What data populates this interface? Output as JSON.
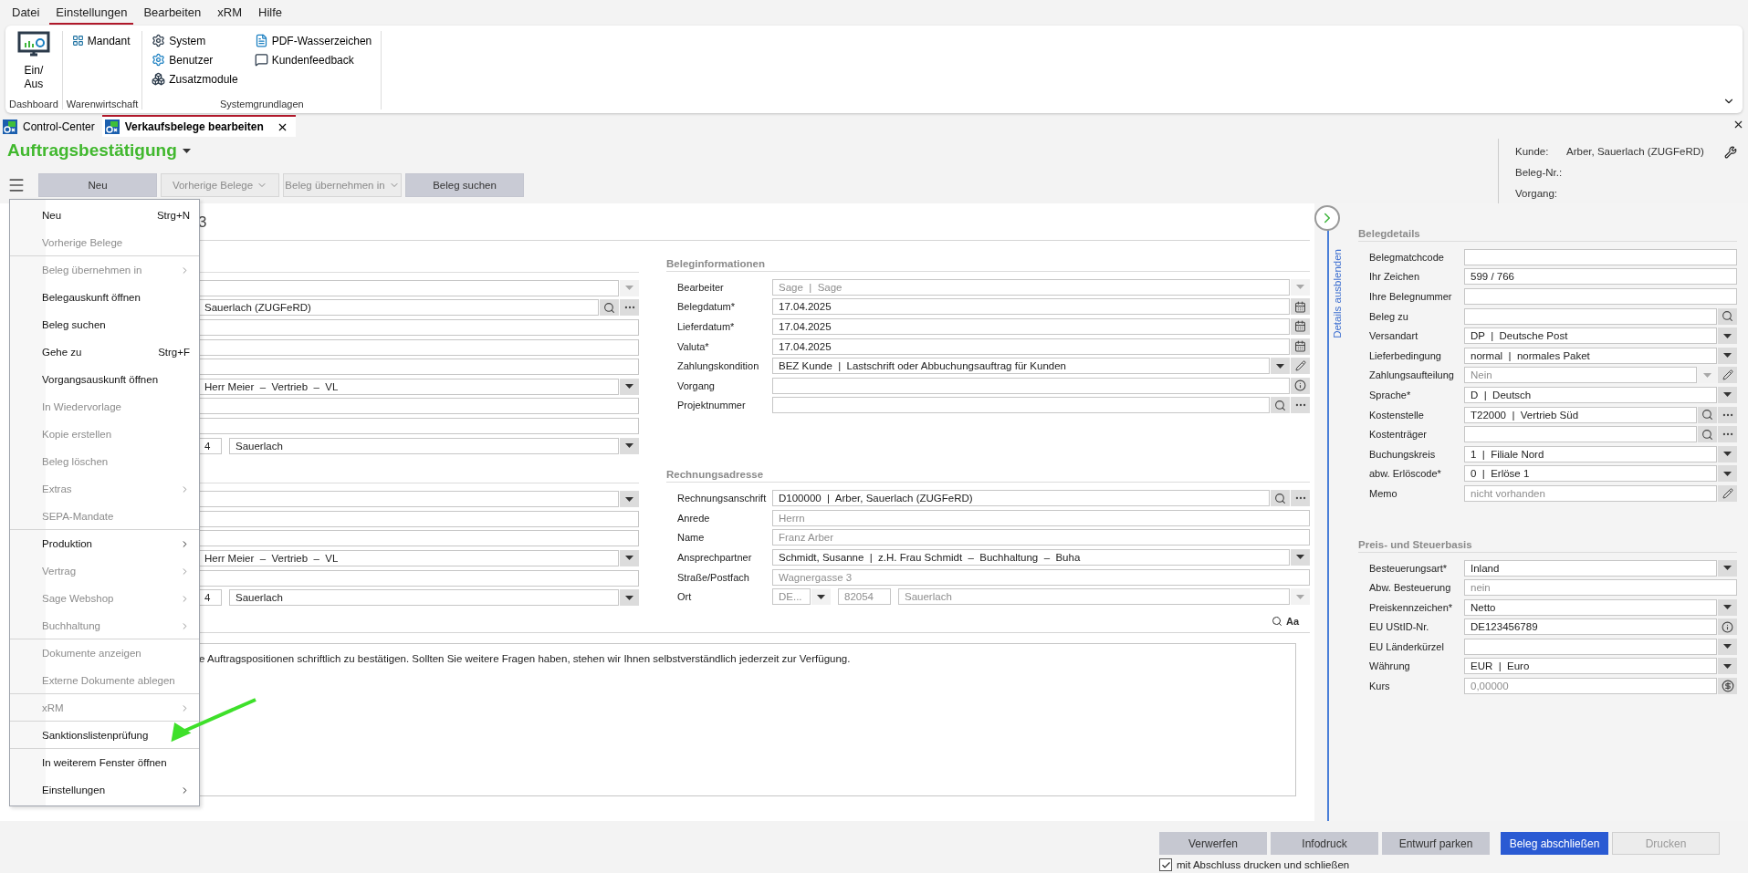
{
  "menu_bar": [
    {
      "label": "Datei",
      "selected": false
    },
    {
      "label": "Einstellungen",
      "selected": true
    },
    {
      "label": "Bearbeiten",
      "selected": false
    },
    {
      "label": "xRM",
      "selected": false
    },
    {
      "label": "Hilfe",
      "selected": false
    }
  ],
  "ribbon": {
    "groups": [
      {
        "label": "Dashboard",
        "kind": "large",
        "items": [
          {
            "label": "Ein/ Aus"
          }
        ]
      },
      {
        "label": "Warenwirtschaft",
        "kind": "small",
        "items": [
          {
            "label": "Mandant"
          }
        ]
      },
      {
        "label": "Systemgrundlagen",
        "kind": "small",
        "items": [
          {
            "label": "System"
          },
          {
            "label": "Benutzer"
          },
          {
            "label": "Zusatzmodule"
          },
          {
            "label": "PDF-Wasserzeichen"
          },
          {
            "label": "Kundenfeedback"
          }
        ]
      }
    ]
  },
  "tabs": [
    {
      "label": "Control-Center",
      "selected": false,
      "closable": false
    },
    {
      "label": "Verkaufsbelege bearbeiten",
      "selected": true,
      "closable": true
    }
  ],
  "document_type": "Auftragsbestätigung",
  "toolbar": [
    {
      "label": "Neu",
      "disabled": false,
      "dropdown": false
    },
    {
      "label": "Vorherige Belege",
      "disabled": true,
      "dropdown": true
    },
    {
      "label": "Beleg übernehmen in",
      "disabled": true,
      "dropdown": true
    },
    {
      "label": "Beleg suchen",
      "disabled": false,
      "dropdown": false
    }
  ],
  "header_info": [
    {
      "label": "Kunde:",
      "value": "Arber, Sauerlach (ZUGFeRD)"
    },
    {
      "label": "Beleg-Nr.:"
    },
    {
      "label": "Vorgang:"
    }
  ],
  "form_title": "3",
  "left_column": [
    {
      "fields": [
        {
          "kind": "select",
          "muted": true
        },
        {
          "kind": "lookup",
          "value": "Sauerlach (ZUGFeRD)",
          "muted": false
        },
        {
          "kind": "text"
        },
        {
          "kind": "text"
        },
        {
          "kind": "text"
        },
        {
          "kind": "select",
          "value": "Herr Meier  –  Vertrieb  –  VL",
          "muted": false
        },
        {
          "kind": "text"
        },
        {
          "kind": "text"
        },
        {
          "kind": "zip_city",
          "zip": "4",
          "city": "Sauerlach",
          "muted": false
        }
      ]
    },
    {
      "fields": [
        {
          "kind": "select",
          "muted": false
        },
        {
          "kind": "text"
        },
        {
          "kind": "text"
        },
        {
          "kind": "select",
          "value": "Herr Meier  –  Vertrieb  –  VL",
          "muted": false
        },
        {
          "kind": "text"
        },
        {
          "kind": "zip_city",
          "zip": "4",
          "city": "Sauerlach",
          "muted": false
        }
      ]
    }
  ],
  "center_column": [
    {
      "title": "Beleginformationen",
      "fields": [
        {
          "label": "Bearbeiter",
          "kind": "select",
          "value": "Sage  |  Sage",
          "muted": true
        },
        {
          "label": "Belegdatum*",
          "kind": "date",
          "value": "17.04.2025",
          "muted": false
        },
        {
          "label": "Lieferdatum*",
          "kind": "date",
          "value": "17.04.2025",
          "muted": false
        },
        {
          "label": "Valuta*",
          "kind": "date",
          "value": "17.04.2025",
          "muted": false
        },
        {
          "label": "Zahlungskondition",
          "kind": "select_edit",
          "value": "BEZ Kunde  |  Lastschrift oder Abbuchungsauftrag für Kunden",
          "muted": false
        },
        {
          "label": "Vorgang",
          "kind": "info"
        },
        {
          "label": "Projektnummer",
          "kind": "lookup"
        }
      ]
    },
    {
      "title": "Rechnungsadresse",
      "fields": [
        {
          "label": "Rechnungsanschrift",
          "kind": "lookup",
          "value": "D100000  |  Arber, Sauerlach (ZUGFeRD)",
          "muted": false
        },
        {
          "label": "Anrede",
          "kind": "text",
          "value": "Herrn",
          "muted": true
        },
        {
          "label": "Name",
          "kind": "text",
          "value": "Franz Arber",
          "muted": true
        },
        {
          "label": "Ansprechpartner",
          "kind": "select",
          "value": "Schmidt, Susanne  |  z.H. Frau Schmidt  –  Buchhaltung  –  Buha",
          "muted": false
        },
        {
          "label": "Straße/Postfach",
          "kind": "text",
          "value": "Wagnergasse 3",
          "muted": true
        },
        {
          "label": "Ort",
          "kind": "address",
          "country": "DE...",
          "zip": "82054",
          "city": "Sauerlach",
          "muted": true
        }
      ]
    }
  ],
  "note_text": "e Auftragspositionen schriftlich zu bestätigen. Sollten Sie weitere Fragen haben, stehen wir Ihnen selbstverständlich jederzeit zur Verfügung.",
  "note_tools": {
    "font_button": "Aa"
  },
  "details_panel": {
    "toggle_label": "Details ausblenden",
    "sections": [
      {
        "title": "Belegdetails",
        "fields": [
          {
            "label": "Belegmatchcode",
            "kind": "text"
          },
          {
            "label": "Ihr Zeichen",
            "kind": "text",
            "value": "599 / 766",
            "muted": false
          },
          {
            "label": "Ihre Belegnummer",
            "kind": "text"
          },
          {
            "label": "Beleg zu",
            "kind": "search"
          },
          {
            "label": "Versandart",
            "kind": "select",
            "value": "DP  |  Deutsche Post",
            "muted": false
          },
          {
            "label": "Lieferbedingung",
            "kind": "select",
            "value": "normal  |  normales Paket",
            "muted": false
          },
          {
            "label": "Zahlungsaufteilung",
            "kind": "select_edit",
            "value": "Nein",
            "muted": true
          },
          {
            "label": "Sprache*",
            "kind": "select",
            "value": "D  |  Deutsch",
            "muted": false
          },
          {
            "label": "Kostenstelle",
            "kind": "lookup",
            "value": "T22000  |  Vertrieb Süd",
            "muted": false
          },
          {
            "label": "Kostenträger",
            "kind": "lookup"
          },
          {
            "label": "Buchungskreis",
            "kind": "select",
            "value": "1  |  Filiale Nord",
            "muted": false
          },
          {
            "label": "abw. Erlöscode*",
            "kind": "select",
            "value": "0  |  Erlöse 1",
            "muted": false
          },
          {
            "label": "Memo",
            "kind": "edit",
            "value": "nicht vorhanden",
            "muted": true
          }
        ]
      },
      {
        "title": "Preis- und Steuerbasis",
        "fields": [
          {
            "label": "Besteuerungsart*",
            "kind": "select",
            "value": "Inland",
            "muted": false
          },
          {
            "label": "Abw. Besteuerung",
            "kind": "text",
            "value": "nein",
            "muted": true
          },
          {
            "label": "Preiskennzeichen*",
            "kind": "select",
            "value": "Netto",
            "muted": false
          },
          {
            "label": "EU UStID-Nr.",
            "kind": "info",
            "value": "DE123456789",
            "muted": false
          },
          {
            "label": "EU Länderkürzel",
            "kind": "select",
            "muted": false
          },
          {
            "label": "Währung",
            "kind": "select",
            "value": "EUR  |  Euro",
            "muted": false
          },
          {
            "label": "Kurs",
            "kind": "currency",
            "value": "0,00000",
            "muted": true
          }
        ]
      }
    ]
  },
  "context_menu": [
    {
      "label": "Neu",
      "shortcut": "Strg+N",
      "disabled": false,
      "submenu": false,
      "divider": false
    },
    {
      "label": "Vorherige Belege",
      "disabled": true,
      "submenu": false,
      "divider": true
    },
    {
      "label": "Beleg übernehmen in",
      "disabled": true,
      "submenu": true,
      "divider": false
    },
    {
      "label": "Belegauskunft öffnen",
      "disabled": false,
      "submenu": false,
      "divider": false
    },
    {
      "label": "Beleg suchen",
      "disabled": false,
      "submenu": false,
      "divider": false
    },
    {
      "label": "Gehe zu",
      "shortcut": "Strg+F",
      "disabled": false,
      "submenu": false,
      "divider": false
    },
    {
      "label": "Vorgangsauskunft öffnen",
      "disabled": false,
      "submenu": false,
      "divider": false
    },
    {
      "label": "In Wiedervorlage",
      "disabled": true,
      "submenu": false,
      "divider": false
    },
    {
      "label": "Kopie erstellen",
      "disabled": true,
      "submenu": false,
      "divider": false
    },
    {
      "label": "Beleg löschen",
      "disabled": true,
      "submenu": false,
      "divider": false
    },
    {
      "label": "Extras",
      "disabled": true,
      "submenu": true,
      "divider": false
    },
    {
      "label": "SEPA-Mandate",
      "disabled": true,
      "submenu": false,
      "divider": true
    },
    {
      "label": "Produktion",
      "disabled": false,
      "submenu": true,
      "divider": false
    },
    {
      "label": "Vertrag",
      "disabled": true,
      "submenu": true,
      "divider": false
    },
    {
      "label": "Sage Webshop",
      "disabled": true,
      "submenu": true,
      "divider": false
    },
    {
      "label": "Buchhaltung",
      "disabled": true,
      "submenu": true,
      "divider": true
    },
    {
      "label": "Dokumente anzeigen",
      "disabled": true,
      "submenu": false,
      "divider": false
    },
    {
      "label": "Externe Dokumente ablegen",
      "disabled": true,
      "submenu": false,
      "divider": true
    },
    {
      "label": "xRM",
      "disabled": true,
      "submenu": true,
      "divider": true
    },
    {
      "label": "Sanktionslistenprüfung",
      "disabled": false,
      "submenu": false,
      "divider": true
    },
    {
      "label": "In weiterem Fenster öffnen",
      "disabled": false,
      "submenu": false,
      "divider": false
    },
    {
      "label": "Einstellungen",
      "disabled": false,
      "submenu": true,
      "divider": false
    }
  ],
  "footer": {
    "buttons": [
      {
        "label": "Verwerfen",
        "kind": "secondary"
      },
      {
        "label": "Infodruck",
        "kind": "secondary"
      },
      {
        "label": "Entwurf parken",
        "kind": "secondary"
      },
      {
        "label": "Beleg abschließen",
        "kind": "primary"
      },
      {
        "label": "Drucken",
        "kind": "disabled"
      }
    ],
    "checkbox": {
      "label": "mit Abschluss drucken und schließen",
      "checked": true
    }
  }
}
